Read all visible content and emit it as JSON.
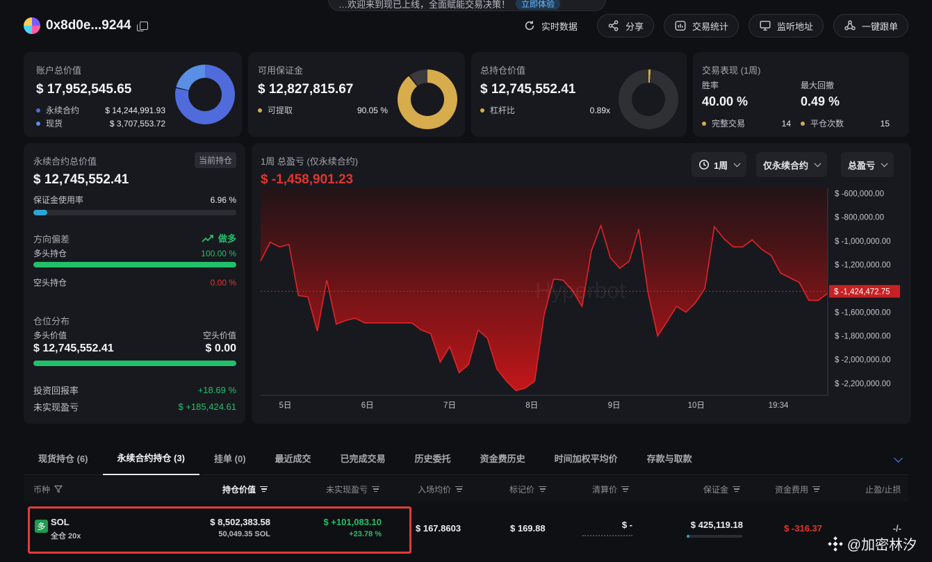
{
  "banner": {
    "text": "…欢迎来到现已上线，全面赋能交易决策！",
    "pill": "立即体验"
  },
  "header": {
    "address": "0x8d0e...9244",
    "actions": {
      "realtime": "实时数据",
      "share": "分享",
      "stats": "交易统计",
      "watch": "监听地址",
      "copy_trade": "一键跟单"
    }
  },
  "account": {
    "label": "账户总价值",
    "value": "$ 17,952,545.65",
    "perp_label": "永续合约",
    "perp_value": "$ 14,244,991.93",
    "spot_label": "现货",
    "spot_value": "$ 3,707,553.72",
    "perp_share": 0.79,
    "perp_color": "#4f6bdc",
    "spot_color": "#5a8fe6"
  },
  "margin": {
    "label": "可用保证金",
    "value": "$ 12,827,815.67",
    "withdraw_label": "可提取",
    "withdraw_value": "90.05 %",
    "withdraw_share": 0.9005,
    "color": "#d6ac4d"
  },
  "position": {
    "label": "总持仓价值",
    "value": "$ 12,745,552.41",
    "leverage_label": "杠杆比",
    "leverage_value": "0.89x",
    "leverage_share": 0.015,
    "color": "#d6ac4d"
  },
  "performance": {
    "label": "交易表现 (1周)",
    "winrate_label": "胜率",
    "winrate_value": "40.00 %",
    "drawdown_label": "最大回撤",
    "drawdown_value": "0.49 %",
    "trades_label": "完整交易",
    "trades_value": "14",
    "closes_label": "平仓次数",
    "closes_value": "15"
  },
  "perp_panel": {
    "label": "永续合约总价值",
    "badge": "当前持仓",
    "value": "$ 12,745,552.41",
    "margin_usage_label": "保证金使用率",
    "margin_usage_value": "6.96 %",
    "margin_usage": 0.0696,
    "bias_label": "方向偏差",
    "bias_value": "做多",
    "long_label": "多头持仓",
    "long_value": "100.00 %",
    "long_share": 1.0,
    "short_label": "空头持仓",
    "short_value": "0.00 %",
    "dist_label": "仓位分布",
    "long_val_label": "多头价值",
    "long_val": "$ 12,745,552.41",
    "short_val_label": "空头价值",
    "short_val": "$ 0.00",
    "roi_label": "投资回报率",
    "roi_value": "+18.69 %",
    "upnl_label": "未实现盈亏",
    "upnl_value": "$ +185,424.61"
  },
  "pnl_chart": {
    "title": "1周 总盈亏 (仅永续合约)",
    "value": "$ -1,458,901.23",
    "controls": {
      "period": "1周",
      "scope": "仅永续合约",
      "metric": "总盈亏"
    },
    "current_label": "$ -1,424,472.75",
    "watermark": "Hyperbot"
  },
  "chart_data": {
    "type": "area",
    "ylim": [
      -2300000,
      -550000
    ],
    "yticks": [
      -600000,
      -800000,
      -1000000,
      -1200000,
      -1400000,
      -1600000,
      -1800000,
      -2000000,
      -2200000
    ],
    "ytick_labels": [
      "$ -600,000.00",
      "$ -800,000.00",
      "$ -1,000,000.00",
      "$ -1,200,000.00",
      "",
      "$ -1,600,000.00",
      "$ -1,800,000.00",
      "$ -2,000,000.00",
      "$ -2,200,000.00"
    ],
    "current": -1424472.75,
    "xlim": [
      0,
      69
    ],
    "xticks": [
      3,
      13,
      23,
      33,
      43,
      53,
      63
    ],
    "xtick_labels": [
      "5日",
      "6日",
      "7日",
      "8日",
      "9日",
      "10日",
      "19:34"
    ],
    "x": [
      0,
      1,
      2,
      3,
      4,
      5,
      6,
      7,
      8,
      9,
      10,
      11,
      12,
      13,
      14,
      15,
      16,
      17,
      18,
      19,
      20,
      21,
      22,
      23,
      24,
      25,
      26,
      27,
      28,
      29,
      30,
      31,
      32,
      33,
      34,
      35,
      36,
      37,
      38,
      39,
      40,
      41,
      42,
      43,
      44,
      45,
      46,
      47,
      48,
      49,
      50,
      51,
      52,
      53,
      54,
      55,
      56,
      57,
      58,
      59,
      60,
      61,
      62,
      63,
      64,
      65,
      66,
      67,
      68,
      69
    ],
    "y": [
      -1170000,
      -1010000,
      -1050000,
      -1030000,
      -1460000,
      -1470000,
      -1760000,
      -1330000,
      -1700000,
      -1670000,
      -1650000,
      -1690000,
      -1690000,
      -1690000,
      -1690000,
      -1690000,
      -1690000,
      -1750000,
      -1780000,
      -2020000,
      -1890000,
      -2110000,
      -2040000,
      -1750000,
      -1820000,
      -2080000,
      -2180000,
      -2260000,
      -2240000,
      -2180000,
      -1620000,
      -1320000,
      -1330000,
      -1420000,
      -1550000,
      -1080000,
      -870000,
      -1140000,
      -1230000,
      -1170000,
      -900000,
      -1440000,
      -1800000,
      -1680000,
      -1550000,
      -1600000,
      -1520000,
      -1400000,
      -880000,
      -980000,
      -1050000,
      -1050000,
      -990000,
      -1070000,
      -1120000,
      -1270000,
      -1310000,
      -1350000,
      -1500000,
      -1500000,
      -1440000
    ],
    "grid": false
  },
  "tabs": {
    "items": [
      "现货持仓 (6)",
      "永续合约持仓 (3)",
      "挂单 (0)",
      "最近成交",
      "已完成交易",
      "历史委托",
      "资金费历史",
      "时间加权平均价",
      "存款与取款"
    ],
    "active": 1
  },
  "table": {
    "headers": {
      "coin": "币种",
      "value": "持仓价值",
      "upnl": "未实现盈亏",
      "entry": "入场均价",
      "mark": "标记价",
      "liq": "清算价",
      "margin": "保证金",
      "funding": "资金费用",
      "tpsl": "止盈/止损"
    },
    "row": {
      "side": "多",
      "coin": "SOL",
      "mode": "全仓 20x",
      "value": "$ 8,502,383.58",
      "size": "50,049.35 SOL",
      "upnl": "$ +101,083.10",
      "upnl_pct": "+23.78 %",
      "entry": "$ 167.8603",
      "mark": "$ 169.88",
      "liq": "$ -",
      "margin": "$ 425,119.18",
      "funding": "$ -316.37",
      "tpsl": "-/-"
    }
  },
  "watermark": {
    "icon": "binance-icon",
    "text": "@加密林汐"
  }
}
